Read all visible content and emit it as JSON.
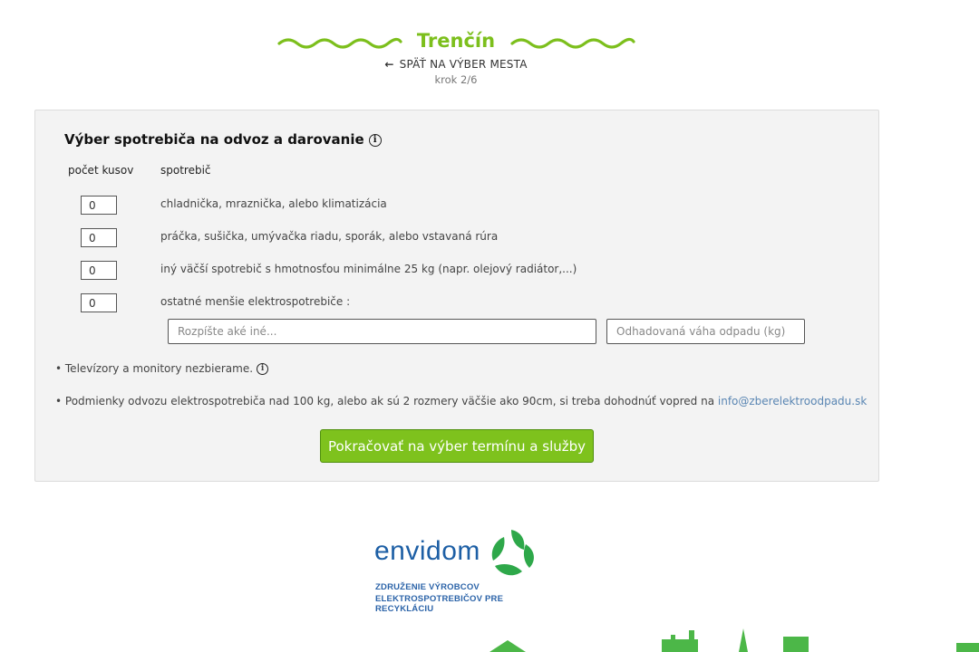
{
  "header": {
    "city": "Trenčín",
    "back_label": "SPÄŤ NA VÝBER MESTA",
    "step": "krok 2/6"
  },
  "form": {
    "title": "Výber spotrebiča na odvoz a darovanie",
    "col_count": "počet kusov",
    "col_item": "spotrebič",
    "rows": [
      {
        "qty": "0",
        "label": "chladnička, mraznička, alebo klimatizácia"
      },
      {
        "qty": "0",
        "label": "práčka, sušička, umývačka riadu, sporák, alebo vstavaná rúra"
      },
      {
        "qty": "0",
        "label": "iný väčší spotrebič s hmotnosťou minimálne 25 kg (napr. olejový radiátor,...)"
      },
      {
        "qty": "0",
        "label": "ostatné menšie elektrospotrebiče :"
      }
    ],
    "other_desc_placeholder": "Rozpíšte aké iné...",
    "other_weight_placeholder": "Odhadovaná váha odpadu (kg)",
    "note_tv": "• Televízory a monitory nezbierame.",
    "note_conditions": "• Podmienky odvozu elektrospotrebiča nad 100 kg, alebo ak sú 2 rozmery väčšie ako 90cm, si treba dohodnúť vopred na ",
    "contact_email": "info@zberelektroodpadu.sk",
    "continue_label": "Pokračovať na výber termínu a služby"
  },
  "logo": {
    "word": "envidom",
    "sub_line1": "ZDRUŽENIE VÝROBCOV",
    "sub_line2": "ELEKTROSPOTREBIČOV PRE RECYKLÁCIU"
  },
  "colors": {
    "accent_green": "#7cbf1c",
    "button_green": "#7ec21d",
    "logo_blue": "#1d5fa5",
    "logo_green": "#2ea84a",
    "link_blue": "#5a86b3"
  },
  "icons": {
    "back": "arrow-left-icon",
    "info": "info-icon",
    "logo_mark": "recycle-leaves-icon"
  }
}
